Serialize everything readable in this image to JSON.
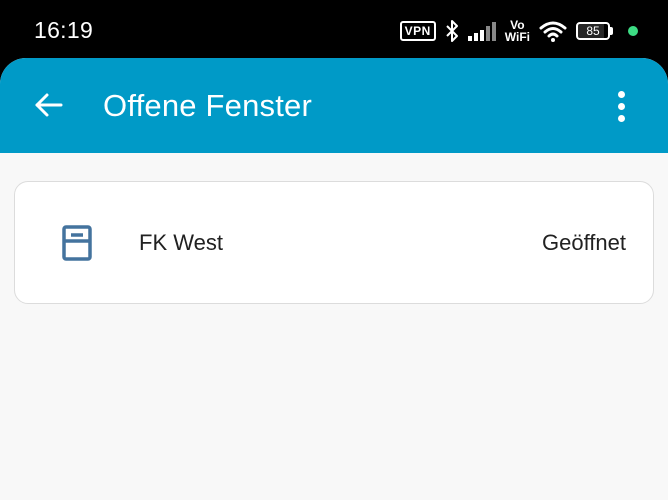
{
  "status_bar": {
    "time": "16:19",
    "vpn_label": "VPN",
    "vowifi_top": "Vo",
    "vowifi_bottom": "WiFi",
    "battery_level": "85",
    "battery_fraction": 0.85,
    "dot_color": "#3ddc84",
    "icons": [
      "vpn-icon",
      "bluetooth-icon",
      "signal-icon",
      "vowifi-icon",
      "wifi-icon",
      "battery-icon"
    ]
  },
  "app_bar": {
    "title": "Offene Fenster",
    "color": "#009ac7",
    "back_icon": "arrow-left-icon",
    "menu_icon": "more-vert-icon"
  },
  "entities": [
    {
      "icon": "window-icon",
      "name": "FK West",
      "state": "Geöffnet"
    }
  ]
}
